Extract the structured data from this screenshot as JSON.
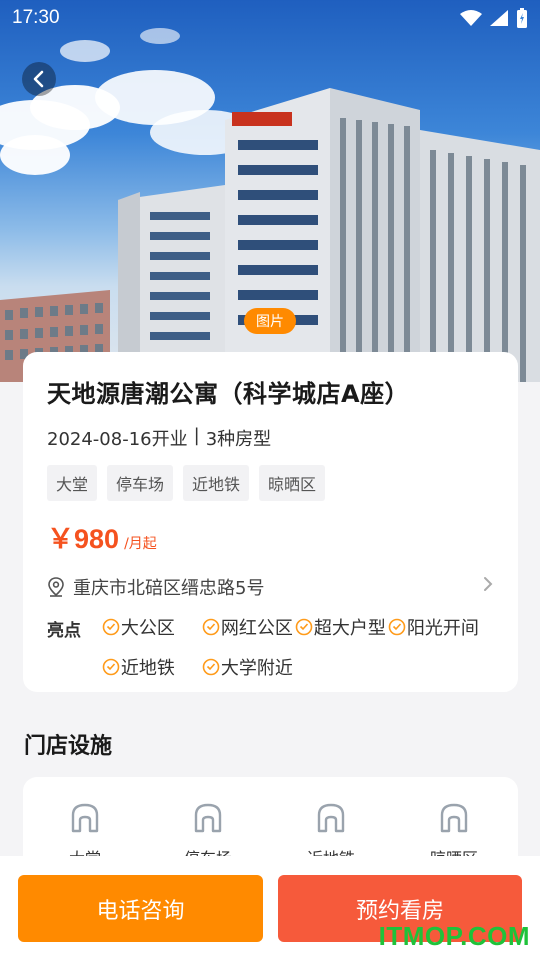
{
  "status_bar": {
    "time": "17:30"
  },
  "hero": {
    "photo_badge": "图片"
  },
  "apartment": {
    "name": "天地源唐潮公寓（科学城店A座）",
    "opened": "2024-08-16开业",
    "separator": "|",
    "room_types": "3种房型",
    "tags": [
      "大堂",
      "停车场",
      "近地铁",
      "晾晒区"
    ],
    "price": "￥980",
    "price_unit": "/月起",
    "address": "重庆市北碚区缙忠路5号",
    "highlights_label": "亮点",
    "highlights": [
      "大公区",
      "网红公区",
      "超大户型",
      "阳光开间",
      "近地铁",
      "大学附近"
    ]
  },
  "facilities": {
    "title": "门店设施",
    "items": [
      "大堂",
      "停车场",
      "近地铁",
      "晾晒区"
    ]
  },
  "actions": {
    "call": "电话咨询",
    "book": "预约看房"
  },
  "watermark": "ITMOP.COM",
  "colors": {
    "orange": "#ff8a00",
    "red": "#f65a3b",
    "price": "#f5521f",
    "watermark": "#1fc23a"
  }
}
